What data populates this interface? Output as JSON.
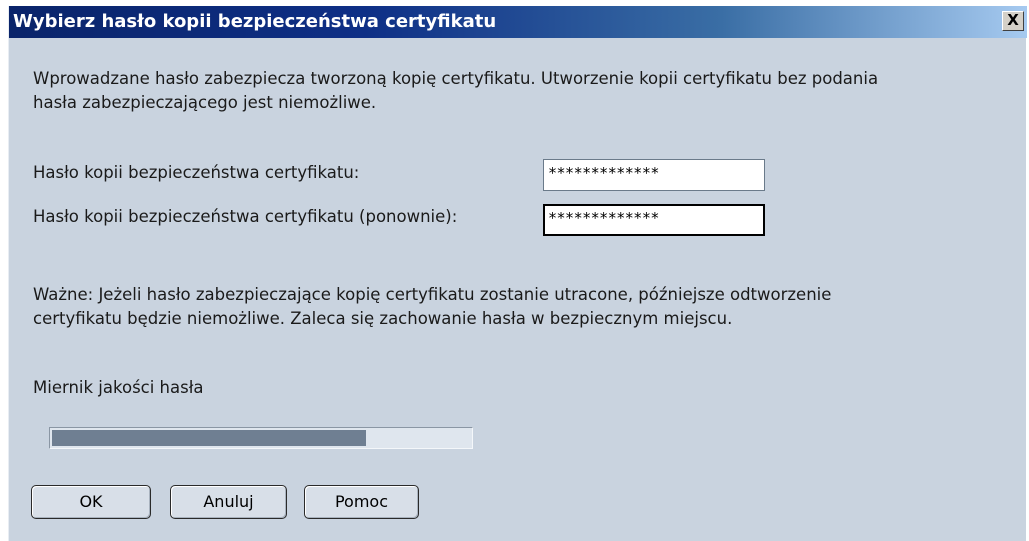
{
  "window": {
    "title": "Wybierz hasło kopii bezpieczeństwa certyfikatu",
    "close_label": "X"
  },
  "intro": {
    "line1": "Wprowadzane hasło zabezpiecza tworzoną kopię certyfikatu. Utworzenie kopii certyfikatu bez podania",
    "line2": "hasła zabezpieczającego jest niemożliwe."
  },
  "fields": {
    "password": {
      "label": "Hasło kopii bezpieczeństwa certyfikatu:",
      "value": "*************"
    },
    "password_confirm": {
      "label": "Hasło kopii bezpieczeństwa certyfikatu (ponownie):",
      "value": "*************"
    }
  },
  "warning": {
    "line1": "Ważne: Jeżeli hasło zabezpieczające kopię certyfikatu zostanie utracone, późniejsze odtworzenie",
    "line2": "certyfikatu będzie niemożliwe. Zaleca się zachowanie hasła w bezpiecznym miejscu."
  },
  "meter": {
    "label": "Miernik jakości hasła",
    "level": 0.75
  },
  "buttons": {
    "ok": "OK",
    "cancel": "Anuluj",
    "help": "Pomoc"
  },
  "colors": {
    "dialog_bg": "#c9d3df",
    "titlebar_start": "#0a246a",
    "titlebar_end": "#a6caf0",
    "meter_fill": "#6f7f92"
  }
}
